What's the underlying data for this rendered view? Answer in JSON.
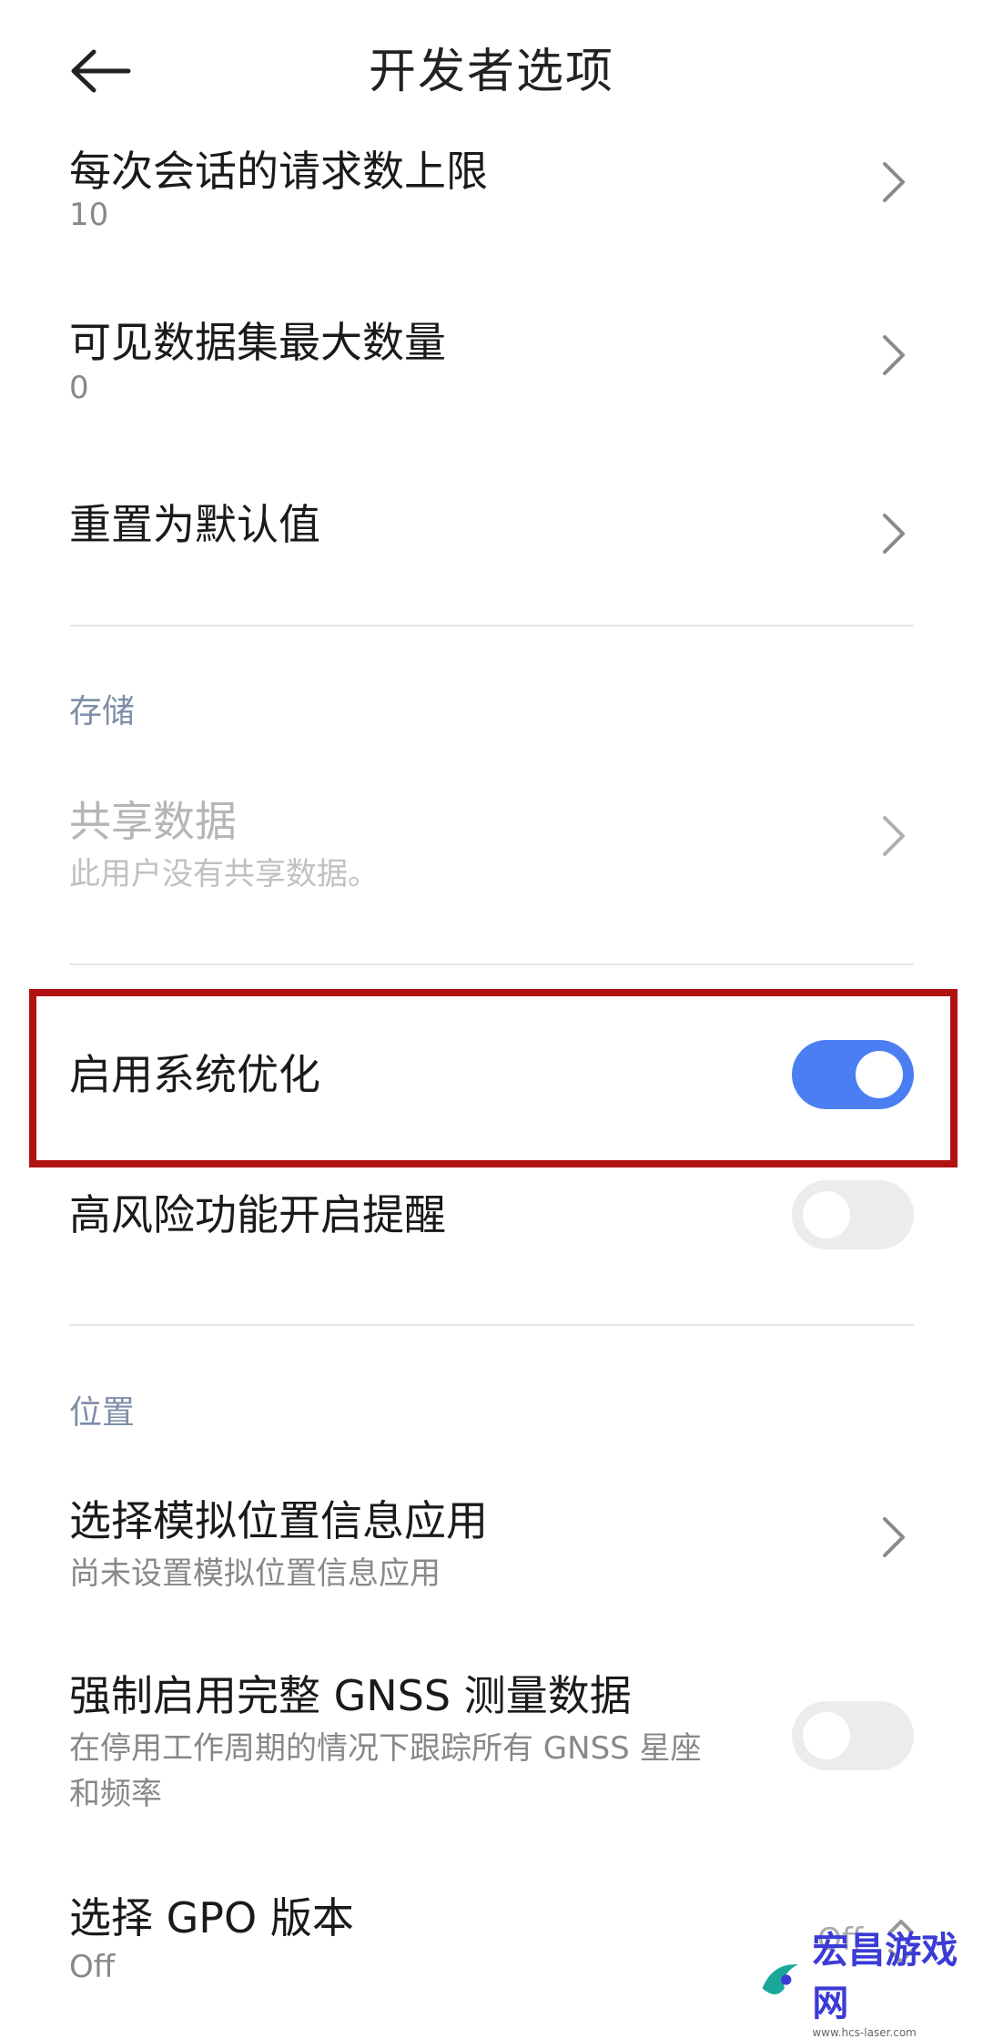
{
  "header": {
    "title": "开发者选项"
  },
  "items": {
    "max_requests": {
      "title": "每次会话的请求数上限",
      "value": "10"
    },
    "max_datasets": {
      "title": "可见数据集最大数量",
      "value": "0"
    },
    "reset_defaults": {
      "title": "重置为默认值"
    },
    "storage_header": "存储",
    "shared_data": {
      "title": "共享数据",
      "subtitle": "此用户没有共享数据。"
    },
    "system_optimization": {
      "title": "启用系统优化",
      "enabled": true
    },
    "risk_reminder": {
      "title": "高风险功能开启提醒",
      "enabled": false
    },
    "location_header": "位置",
    "mock_location": {
      "title": "选择模拟位置信息应用",
      "subtitle": "尚未设置模拟位置信息应用"
    },
    "gnss": {
      "title": "强制启用完整 GNSS 测量数据",
      "subtitle_line1": "在停用工作周期的情况下跟踪所有 GNSS 星座",
      "subtitle_line2": "和频率",
      "enabled": false
    },
    "gpo": {
      "title": "选择 GPO 版本",
      "value": "Off",
      "selector_value": "Off"
    }
  },
  "watermark": {
    "text": "宏昌游戏网",
    "url": "www.hcs-laser.com"
  },
  "colors": {
    "accent": "#4a7ef2",
    "highlight": "#b11212",
    "section_header": "#7f8ea8"
  }
}
